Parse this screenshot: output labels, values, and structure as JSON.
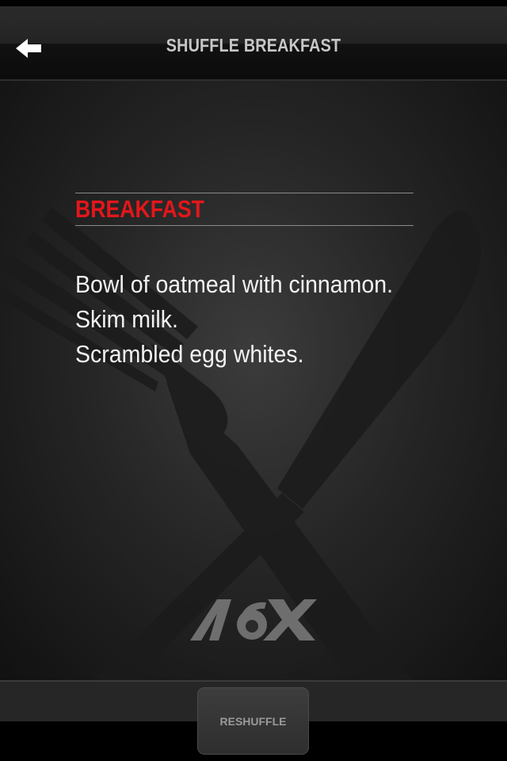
{
  "nav": {
    "title": "SHUFFLE BREAKFAST",
    "back_icon": "arrow-left-icon"
  },
  "meal": {
    "heading": "BREAKFAST",
    "items": [
      "Bowl of oatmeal with cinnamon.",
      "Skim milk.",
      "Scrambled egg whites."
    ]
  },
  "background": {
    "art_icon": "fork-and-knife-crossed-icon"
  },
  "logo": {
    "text": "A6X"
  },
  "footer": {
    "reshuffle_label": "RESHUFFLE"
  },
  "colors": {
    "heading_red": "#e4161b",
    "text_white": "#f2f2f2",
    "title_gray": "#c7c7c7"
  }
}
